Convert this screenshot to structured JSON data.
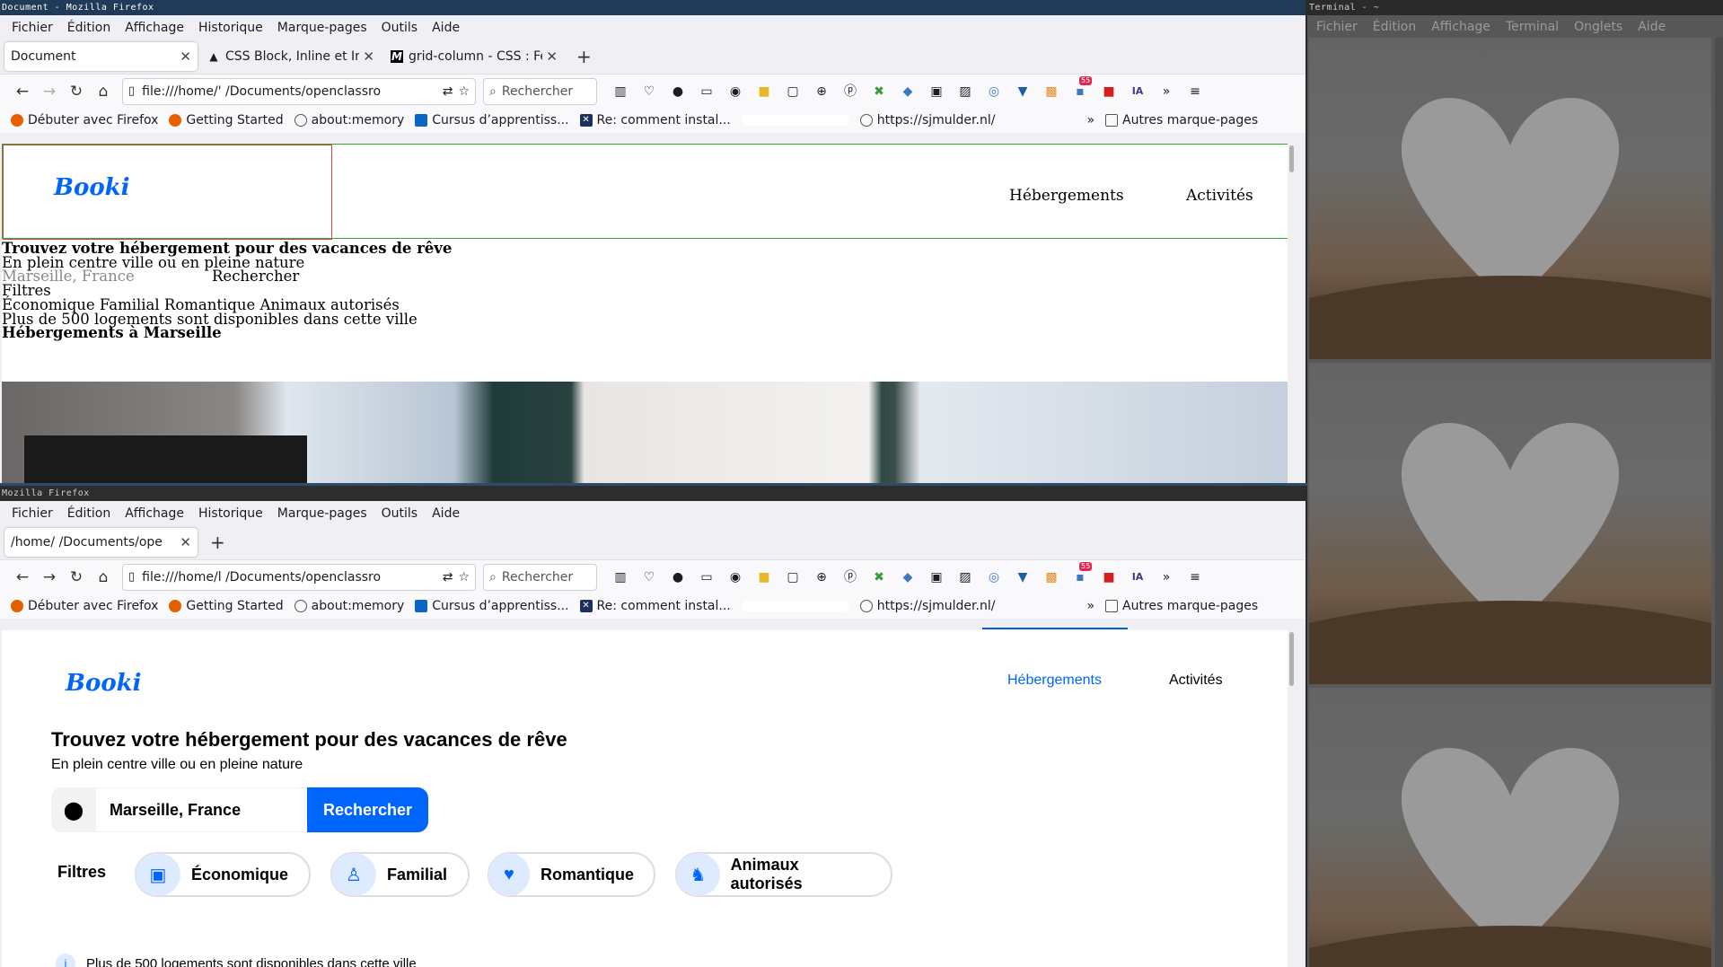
{
  "top_window": {
    "title": "Document - Mozilla Firefox",
    "menu": [
      "Fichier",
      "Édition",
      "Affichage",
      "Historique",
      "Marque-pages",
      "Outils",
      "Aide"
    ],
    "tabs": [
      {
        "title": "Document",
        "active": true,
        "icon": "none"
      },
      {
        "title": "CSS Block, Inline et Inlin",
        "active": false,
        "icon": "triangle-icon"
      },
      {
        "title": "grid-column - CSS : Feui",
        "active": false,
        "icon": "mdn-icon"
      }
    ],
    "url": "file:///home/'      /Documents/openclassro",
    "search_placeholder": "Rechercher",
    "bookmarks": [
      "Débuter avec Firefox",
      "Getting Started",
      "about:memory",
      "Cursus d’apprentiss...",
      "Re: comment instal...",
      "https://sjmulder.nl/"
    ],
    "other_bookmarks": "Autres marque-pages",
    "badge": "55",
    "page": {
      "logo": "Booki",
      "nav": [
        "Hébergements",
        "Activités"
      ],
      "lines": [
        "Trouvez votre hébergement pour des vacances de rêve",
        "En plein centre ville ou en pleine nature",
        "Marseille, France",
        "Rechercher",
        "Filtres",
        "Économique Familial Romantique Animaux autorisés",
        "Plus de 500 logements sont disponibles dans cette ville",
        "Hébergements à Marseille"
      ]
    }
  },
  "bottom_window": {
    "title": "Mozilla Firefox",
    "menu": [
      "Fichier",
      "Édition",
      "Affichage",
      "Historique",
      "Marque-pages",
      "Outils",
      "Aide"
    ],
    "tabs": [
      {
        "title": "/home/      /Documents/ope",
        "active": true
      }
    ],
    "url": "file:///home/l      /Documents/openclassro",
    "search_placeholder": "Rechercher",
    "bookmarks": [
      "Débuter avec Firefox",
      "Getting Started",
      "about:memory",
      "Cursus d’apprentiss...",
      "Re: comment instal...",
      "https://sjmulder.nl/"
    ],
    "other_bookmarks": "Autres marque-pages",
    "badge": "55",
    "page": {
      "logo": "Booki",
      "nav": [
        "Hébergements",
        "Activités"
      ],
      "heading": "Trouvez votre hébergement pour des vacances de rêve",
      "subheading": "En plein centre ville ou en pleine nature",
      "search_value": "Marseille, France",
      "search_button": "Rechercher",
      "filters_label": "Filtres",
      "filters": [
        "Économique",
        "Familial",
        "Romantique",
        "Animaux autorisés"
      ],
      "info": "Plus de 500 logements sont disponibles dans cette ville",
      "accent": "#0065fc"
    }
  },
  "terminal": {
    "title": "Terminal -           ~",
    "menu": [
      "Fichier",
      "Édition",
      "Affichage",
      "Terminal",
      "Onglets",
      "Aide"
    ],
    "prompt": "$"
  }
}
